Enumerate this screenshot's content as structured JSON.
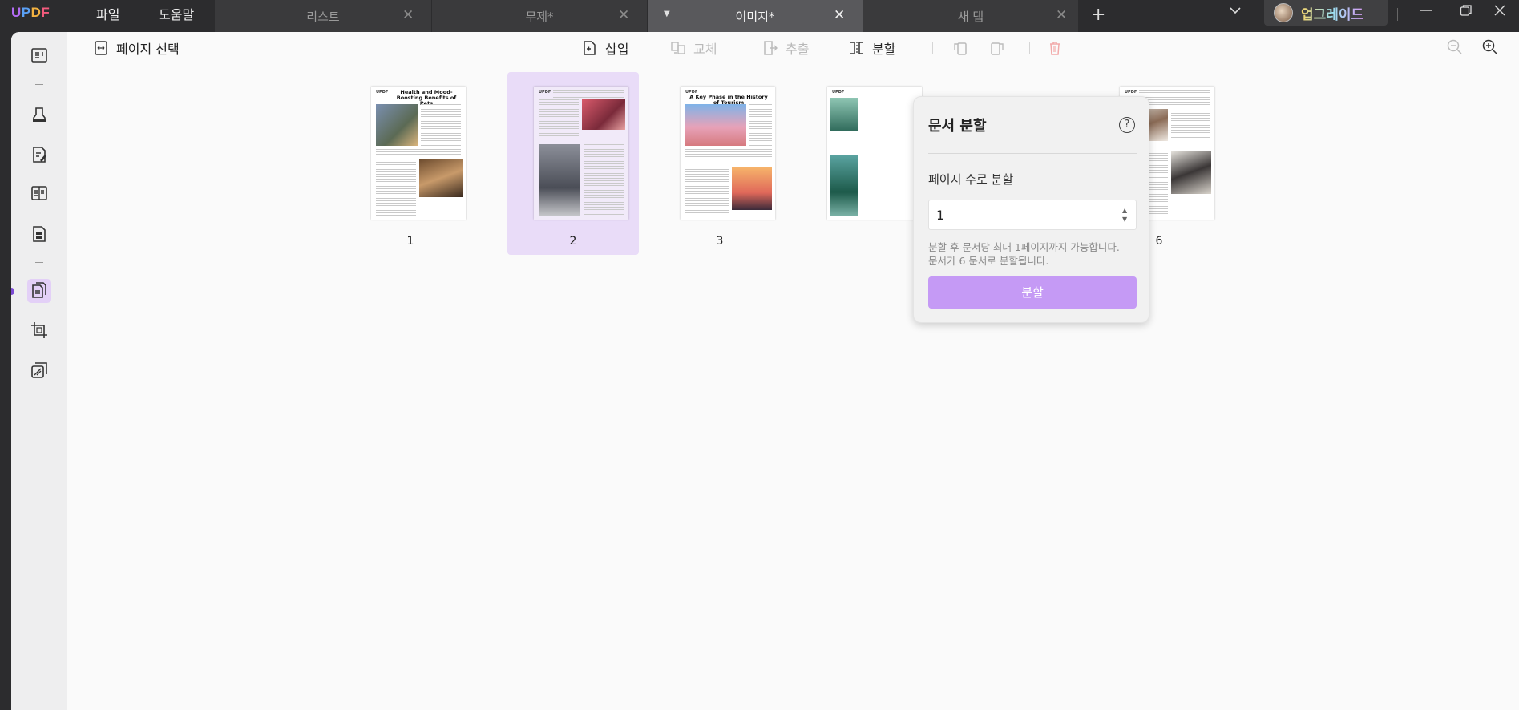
{
  "app": {
    "logo": "UPDF",
    "menu": [
      "파일",
      "도움말"
    ],
    "upgrade_label": "업그레이드"
  },
  "tabs": [
    {
      "label": "리스트",
      "active": false
    },
    {
      "label": "무제*",
      "active": false
    },
    {
      "label": "이미지*",
      "active": true
    },
    {
      "label": "새 탭",
      "active": false
    }
  ],
  "toolbar": {
    "select_pages": "페이지 선택",
    "insert": "삽입",
    "replace": "교체",
    "extract": "추출",
    "split": "분할"
  },
  "sidebar": {
    "items": [
      "reader-icon",
      "highlighter-icon",
      "edit-pdf-icon",
      "columns-icon",
      "form-icon",
      "organize-pages-icon",
      "crop-icon",
      "layers-icon"
    ],
    "active_item": "organize-pages-icon"
  },
  "pages": [
    {
      "number": "1",
      "title": "Health and Mood-Boosting Benefits of Pets",
      "selected": false
    },
    {
      "number": "2",
      "title": "",
      "selected": true
    },
    {
      "number": "3",
      "title": "A Key Phase in the History of Tourism",
      "selected": false
    },
    {
      "number": "",
      "title": "",
      "selected": false
    },
    {
      "number": "6",
      "title": "",
      "selected": false
    }
  ],
  "page_text": {
    "header_mark": "UPDF",
    "p1_sub": "Possible Health Effects",
    "p2_sub": "Animals Helping People",
    "p3_sub": "Why to Take a Flight Tour"
  },
  "popover": {
    "title": "문서 분할",
    "help": "?",
    "label": "페이지 수로 분할",
    "value": "1",
    "hint_line1": "분할 후 문서당 최대 1페이지까지 가능합니다.",
    "hint_line2": "문서가 6 문서로 분할됩니다.",
    "button": "분할"
  },
  "colors": {
    "accent": "#c59af5",
    "selected_bg": "#e9dcf8",
    "active_sidebar": "#e3d0f7"
  }
}
